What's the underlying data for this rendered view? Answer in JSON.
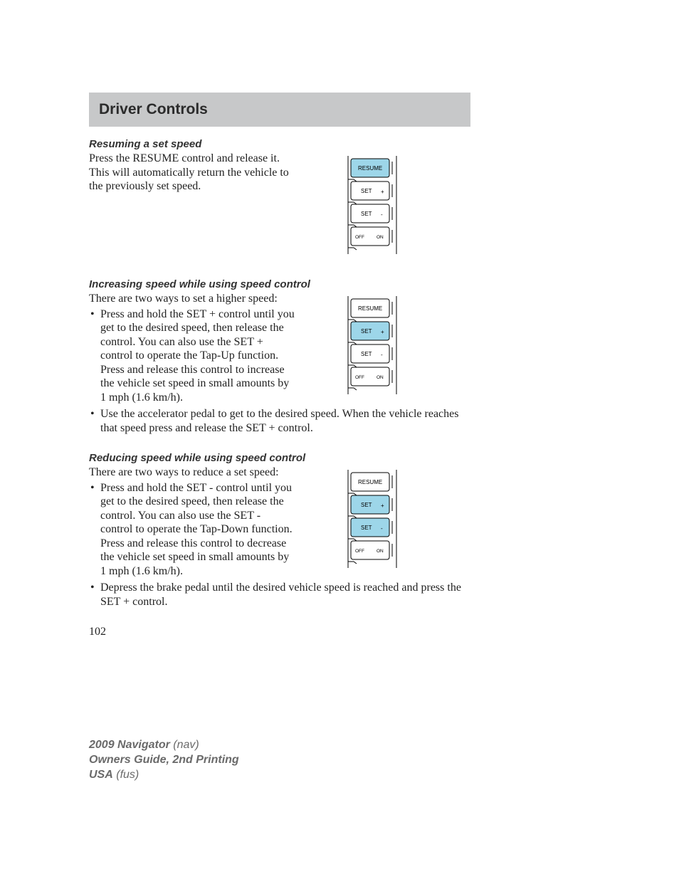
{
  "header": {
    "title": "Driver Controls"
  },
  "section1": {
    "heading": "Resuming a set speed",
    "para": "Press the RESUME control and release it. This will automatically return the vehicle to the previously set speed.",
    "diagram_hl": [
      0
    ]
  },
  "section2": {
    "heading": "Increasing speed while using speed control",
    "intro": "There are two ways to set a higher speed:",
    "bullet1": "Press and hold the SET + control until you get to the desired speed, then release the control. You can also use the SET + control to operate the Tap-Up function. Press and release this control to increase the vehicle set speed in small amounts by 1 mph (1.6 km/h).",
    "bullet2": "Use the accelerator pedal to get to the desired speed. When the vehicle reaches that speed press and release the SET + control.",
    "diagram_hl": [
      1
    ]
  },
  "section3": {
    "heading": "Reducing speed while using speed control",
    "intro": "There are two ways to reduce a set speed:",
    "bullet1": "Press and hold the SET - control until you get to the desired speed, then release the control. You can also use the SET - control to operate the Tap-Down function. Press and release this control to decrease the vehicle set speed in small amounts by 1 mph (1.6 km/h).",
    "bullet2": "Depress the brake pedal until the desired vehicle speed is reached and press the SET + control.",
    "diagram_hl": [
      1,
      2
    ]
  },
  "diagram_labels": {
    "resume": "RESUME",
    "set_plus": "SET",
    "set_plus_sym": "+",
    "set_minus": "SET",
    "set_minus_sym": "-",
    "off": "OFF",
    "on": "ON"
  },
  "page_number": "102",
  "footer": {
    "l1a": "2009 Navigator",
    "l1b": "(nav)",
    "l2a": "Owners Guide, 2nd Printing",
    "l3a": "USA",
    "l3b": "(fus)"
  }
}
